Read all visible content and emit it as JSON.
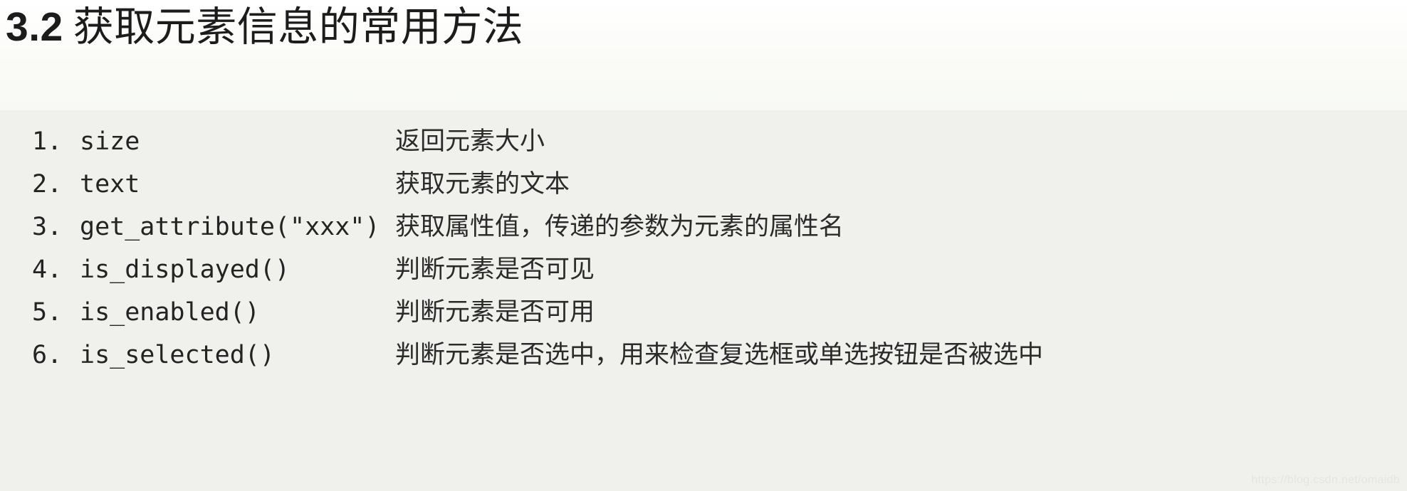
{
  "heading": {
    "section_number": "3.2",
    "section_text": "获取元素信息的常用方法"
  },
  "code_block": {
    "rows": [
      {
        "index": "1.",
        "code": "size",
        "desc": "返回元素大小"
      },
      {
        "index": "2.",
        "code": "text",
        "desc": "获取元素的文本"
      },
      {
        "index": "3.",
        "code": "get_attribute(\"xxx\")",
        "desc": "获取属性值，传递的参数为元素的属性名"
      },
      {
        "index": "4.",
        "code": "is_displayed()",
        "desc": "判断元素是否可见"
      },
      {
        "index": "5.",
        "code": "is_enabled()",
        "desc": "判断元素是否可用"
      },
      {
        "index": "6.",
        "code": "is_selected()",
        "desc": "判断元素是否选中，用来检查复选框或单选按钮是否被选中"
      }
    ]
  },
  "watermark": {
    "text": "https://blog.csdn.net/omaidb"
  },
  "colors": {
    "heading_background": "#fbfcf8",
    "code_background": "#f0f1ed",
    "text": "#232323",
    "watermark": "#e3e5e0"
  }
}
